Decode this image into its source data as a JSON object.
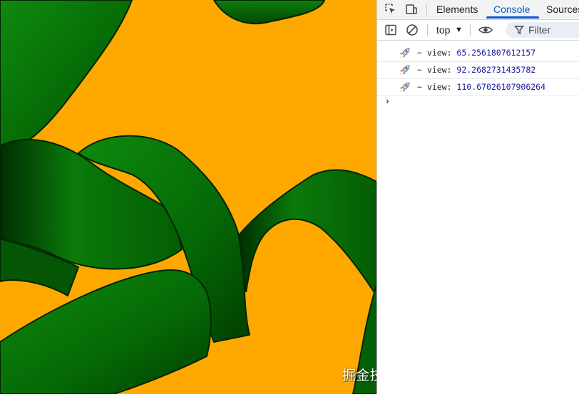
{
  "devtools": {
    "tabs": [
      "Elements",
      "Console",
      "Sources"
    ],
    "active_tab": "Console",
    "toolbar": {
      "context": "top",
      "filter_placeholder": "Filter"
    },
    "logs": [
      {
        "prefix": "~ view:",
        "value": "65.2561807612157"
      },
      {
        "prefix": "~ view:",
        "value": "92.2682731435782"
      },
      {
        "prefix": "~ view:",
        "value": "110.67026107906264"
      }
    ],
    "prompt_symbol": "›"
  },
  "viewport": {
    "background_color": "#FFA800",
    "ribbon_color": "#0A7A0A"
  },
  "watermark": "掘金技术社区 @ 敲敲敲敲暴你脑袋",
  "icons": {
    "inspect": "inspect-element-icon",
    "device": "device-toolbar-icon",
    "sidebar": "console-sidebar-icon",
    "clear": "clear-console-icon",
    "eye": "live-expression-icon",
    "filter": "filter-icon",
    "log": "rocket-icon"
  }
}
